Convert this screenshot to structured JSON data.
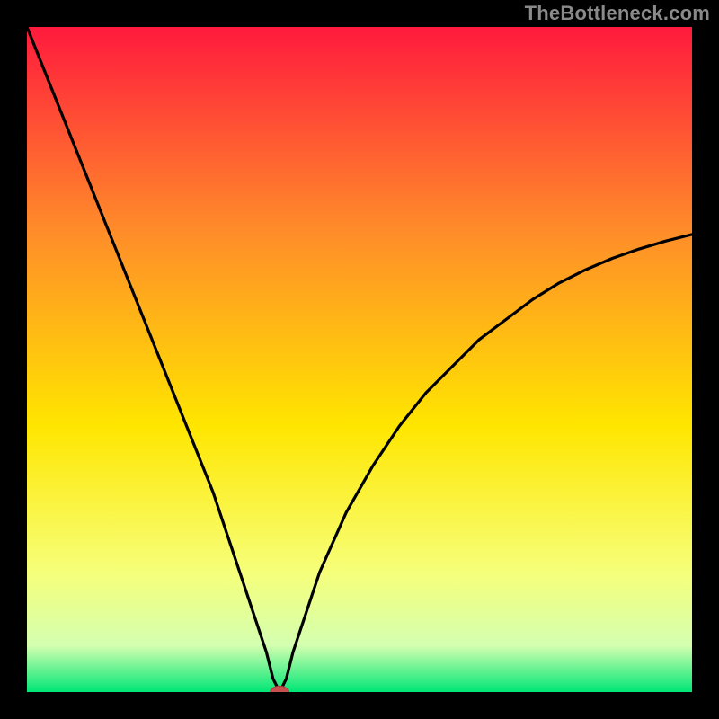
{
  "watermark": "TheBottleneck.com",
  "chart_data": {
    "type": "line",
    "title": "",
    "xlabel": "",
    "ylabel": "",
    "xlim": [
      0,
      100
    ],
    "ylim": [
      0,
      100
    ],
    "grid": false,
    "x_optimum": 38,
    "colors": {
      "frame": "#000000",
      "gradient_top": "#ff1a3d",
      "gradient_upper_mid": "#ff8a2a",
      "gradient_mid": "#ffe600",
      "gradient_lower_mid": "#f6ff7a",
      "gradient_near_bottom": "#d4ffb0",
      "gradient_bottom": "#00e676",
      "curve": "#000000",
      "marker_fill": "#c94f4f",
      "marker_stroke": "#b23b3b"
    },
    "series": [
      {
        "name": "bottleneck-curve",
        "x": [
          0,
          4,
          8,
          12,
          16,
          20,
          24,
          28,
          32,
          34,
          36,
          37,
          38,
          39,
          40,
          42,
          44,
          48,
          52,
          56,
          60,
          64,
          68,
          72,
          76,
          80,
          84,
          88,
          92,
          96,
          100
        ],
        "values": [
          100,
          90,
          80,
          70,
          60,
          50,
          40,
          30,
          18,
          12,
          6,
          2,
          0,
          2,
          6,
          12,
          18,
          27,
          34,
          40,
          45,
          49,
          53,
          56,
          59,
          61.5,
          63.5,
          65.2,
          66.6,
          67.8,
          68.8
        ]
      }
    ],
    "marker": {
      "x": 38,
      "y": 0,
      "rx": 1.4,
      "ry": 0.9
    }
  },
  "plot_geometry": {
    "outer_w": 800,
    "outer_h": 800,
    "pad_left": 30,
    "pad_right": 30,
    "pad_top": 30,
    "pad_bottom": 30,
    "frame_stroke_w": 30
  }
}
